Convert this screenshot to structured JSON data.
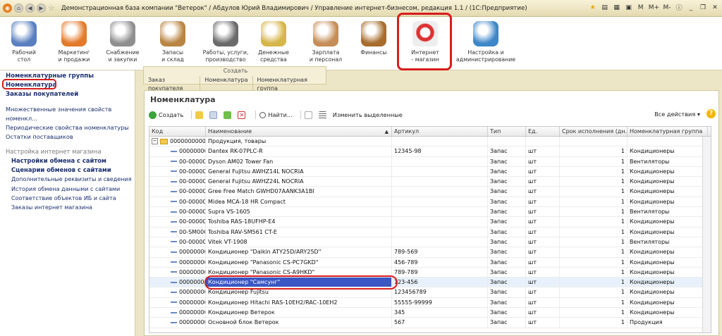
{
  "title": "Демонстрационная база компании \"Ветерок\" / Абдулов Юрий Владимирович / Управление интернет-бизнесом, редакция 1.1 / (1С:Предприятие)",
  "title_controls": [
    "M",
    "M+",
    "M-"
  ],
  "sections": [
    {
      "label": "Рабочий\nстол",
      "icon": "desktop-icon"
    },
    {
      "label": "Маркетинг\nи продажи",
      "icon": "marketing-chart-icon"
    },
    {
      "label": "Снабжение\nи закупки",
      "icon": "truck-icon"
    },
    {
      "label": "Запасы\nи склад",
      "icon": "boxes-icon"
    },
    {
      "label": "Работы, услуги,\nпроизводство",
      "icon": "toolbox-icon"
    },
    {
      "label": "Денежные\nсредства",
      "icon": "coins-icon"
    },
    {
      "label": "Зарплата\nи персонал",
      "icon": "person-icon"
    },
    {
      "label": "Финансы",
      "icon": "abacus-icon"
    },
    {
      "label": "Интернет\n- магазин",
      "icon": "web-cart-icon"
    },
    {
      "label": "Настройка и\nадминистрирование",
      "icon": "settings-computer-icon"
    }
  ],
  "sidebar": {
    "items_top": [
      "Номенклатурные группы",
      "Номенклатура",
      "Заказы покупателей"
    ],
    "items_mid": [
      "Множественные значения свойств номенкл...",
      "Периодические свойства номенклатуры",
      "Остатки поставщиков"
    ],
    "settings_head": "Настройка интернет магазина",
    "settings_bold": [
      "Настройки обмена с сайтом",
      "Сценарии обменов с сайтами"
    ],
    "settings_items": [
      "Дополнительные реквизиты и сведения",
      "История обмена данными с сайтами",
      "Соответствие объектов ИБ и сайта",
      "Заказы интернет магазина"
    ]
  },
  "create": {
    "label": "Создать",
    "items": [
      "Заказ покупателя",
      "Номенклатура",
      "Номенклатурная группа"
    ]
  },
  "content": {
    "title": "Номенклатура",
    "toolbar": {
      "create": "Создать",
      "find": "Найти...",
      "change_selected": "Изменить выделенные",
      "all_actions": "Все действия",
      "help": "?"
    },
    "columns": [
      "Код",
      "Наименование",
      "Артикул",
      "Тип",
      "Ед.",
      "Срок исполнения (дн.)",
      "Номенклатурная группа"
    ],
    "rows": [
      {
        "code": "00000000003",
        "name": "Продукция, товары",
        "article": "",
        "type": "",
        "unit": "",
        "term": "",
        "group": "",
        "folder": true
      },
      {
        "code": "000000000",
        "name": "Dantex RK-07PLC-R",
        "article": "12345-98",
        "type": "Запас",
        "unit": "шт",
        "term": "1",
        "group": "Кондиционеры"
      },
      {
        "code": "00-000000",
        "name": "Dyson AM02 Tower Fan",
        "article": "",
        "type": "Запас",
        "unit": "шт",
        "term": "1",
        "group": "Вентиляторы"
      },
      {
        "code": "00-000000",
        "name": "General Fujitsu AWHZ14L NOCRIA",
        "article": "",
        "type": "Запас",
        "unit": "шт",
        "term": "1",
        "group": "Кондиционеры"
      },
      {
        "code": "00-000000",
        "name": "General Fujitsu AWHZ24L NOCRIA",
        "article": "",
        "type": "Запас",
        "unit": "шт",
        "term": "1",
        "group": "Кондиционеры"
      },
      {
        "code": "00-000000",
        "name": "Gree Free Match GWHD07AANK3A1BI",
        "article": "",
        "type": "Запас",
        "unit": "шт",
        "term": "1",
        "group": "Кондиционеры"
      },
      {
        "code": "00-000000",
        "name": "Midea MCA-18 HR Compact",
        "article": "",
        "type": "Запас",
        "unit": "шт",
        "term": "1",
        "group": "Кондиционеры"
      },
      {
        "code": "00-000000",
        "name": "Supra VS-1605",
        "article": "",
        "type": "Запас",
        "unit": "шт",
        "term": "1",
        "group": "Вентиляторы"
      },
      {
        "code": "00-000000",
        "name": "Toshiba RAS-18UFHP-E4",
        "article": "",
        "type": "Запас",
        "unit": "шт",
        "term": "1",
        "group": "Кондиционеры"
      },
      {
        "code": "00-SM0000",
        "name": "Toshiba RAV-SM561 CT-E",
        "article": "",
        "type": "Запас",
        "unit": "шт",
        "term": "1",
        "group": "Кондиционеры"
      },
      {
        "code": "00-000000",
        "name": "Vitek VT-1908",
        "article": "",
        "type": "Запас",
        "unit": "шт",
        "term": "1",
        "group": "Вентиляторы"
      },
      {
        "code": "000000000",
        "name": "Кондиционер \"Daikin ATY25D/ARY25D\"",
        "article": "789-569",
        "type": "Запас",
        "unit": "шт",
        "term": "1",
        "group": "Кондиционеры"
      },
      {
        "code": "000000000",
        "name": "Кондиционер \"Panasonic CS-PC7GKD\"",
        "article": "456-789",
        "type": "Запас",
        "unit": "шт",
        "term": "1",
        "group": "Кондиционеры"
      },
      {
        "code": "000000000",
        "name": "Кондиционер \"Panasonic CS-A9HKD\"",
        "article": "789-789",
        "type": "Запас",
        "unit": "шт",
        "term": "1",
        "group": "Кондиционеры"
      },
      {
        "code": "000000000",
        "name": "Кондиционер \"Самсунг\"",
        "article": "123-456",
        "type": "Запас",
        "unit": "шт",
        "term": "1",
        "group": "Кондиционеры",
        "selected": true
      },
      {
        "code": "000000000",
        "name": "Кондиционер Fujitsu",
        "article": "123456789",
        "type": "Запас",
        "unit": "шт",
        "term": "1",
        "group": "Кондиционеры"
      },
      {
        "code": "000000000",
        "name": "Кондиционер Hitachi RAS-10EH2/RAC-10EH2",
        "article": "55555-99999",
        "type": "Запас",
        "unit": "шт",
        "term": "1",
        "group": "Кондиционеры"
      },
      {
        "code": "000000000",
        "name": "Кондиционер Ветерок",
        "article": "345",
        "type": "Запас",
        "unit": "шт",
        "term": "1",
        "group": "Кондиционеры"
      },
      {
        "code": "000000000",
        "name": "Основной блок Ветерок",
        "article": "567",
        "type": "Запас",
        "unit": "шт",
        "term": "1",
        "group": "Продукция"
      }
    ]
  },
  "colors": {
    "accent_red": "#d81d1d",
    "link_blue": "#1b2f6e",
    "selection": "#3a57c4"
  }
}
